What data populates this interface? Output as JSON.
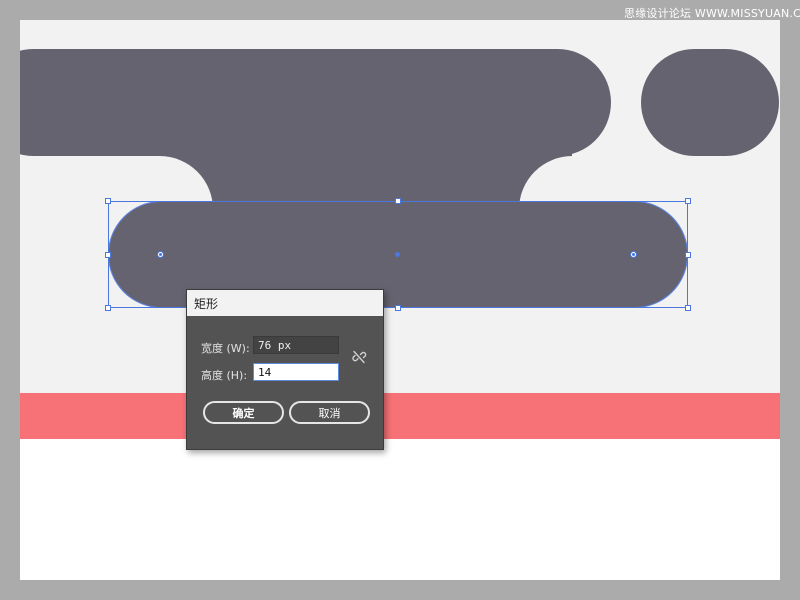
{
  "watermark": "思缘设计论坛 WWW.MISSYUAN.COM",
  "canvas": {
    "shape_color": "#65636f",
    "background_color": "#f2f2f2",
    "band_color": "#f67276",
    "selection_color": "#4a78e0"
  },
  "dialog": {
    "title": "矩形",
    "width_label": "宽度 (W):",
    "width_value": "76 px",
    "height_label": "高度 (H):",
    "height_value": "14",
    "constrain_icon": "unlink-icon",
    "ok_label": "确定",
    "cancel_label": "取消"
  }
}
